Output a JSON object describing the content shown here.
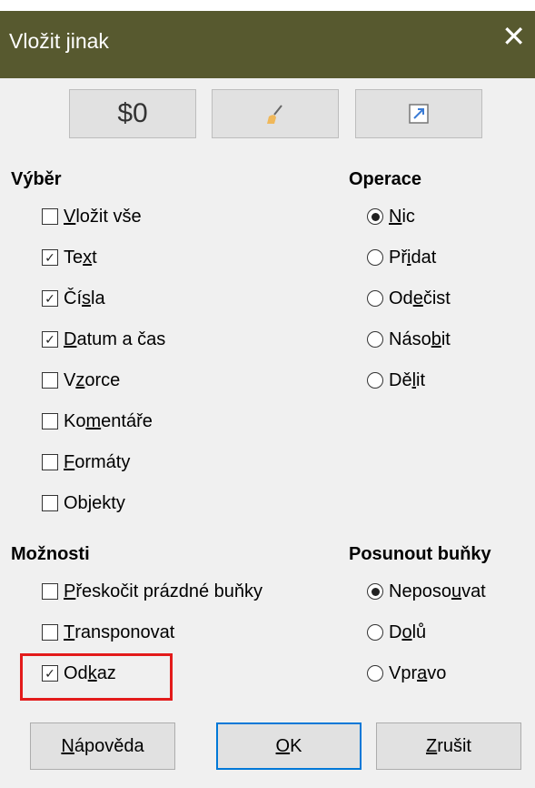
{
  "window": {
    "title": "Vložit jinak"
  },
  "toolbar": {
    "values_only_label": "$0"
  },
  "selection": {
    "title": "Výběr",
    "items": [
      {
        "pre": "",
        "ul": "V",
        "post": "ložit vše",
        "checked": false
      },
      {
        "pre": "Te",
        "ul": "x",
        "post": "t",
        "checked": true
      },
      {
        "pre": "Čí",
        "ul": "s",
        "post": "la",
        "checked": true
      },
      {
        "pre": "",
        "ul": "D",
        "post": "atum a čas",
        "checked": true
      },
      {
        "pre": "V",
        "ul": "z",
        "post": "orce",
        "checked": false
      },
      {
        "pre": "Ko",
        "ul": "m",
        "post": "entáře",
        "checked": false
      },
      {
        "pre": "",
        "ul": "F",
        "post": "ormáty",
        "checked": false
      },
      {
        "pre": "Ob",
        "ul": "j",
        "post": "ekty",
        "checked": false
      }
    ]
  },
  "operation": {
    "title": "Operace",
    "items": [
      {
        "pre": "",
        "ul": "N",
        "post": "ic",
        "selected": true
      },
      {
        "pre": "Př",
        "ul": "i",
        "post": "dat",
        "selected": false
      },
      {
        "pre": "Od",
        "ul": "e",
        "post": "čist",
        "selected": false
      },
      {
        "pre": "Náso",
        "ul": "b",
        "post": "it",
        "selected": false
      },
      {
        "pre": "Dě",
        "ul": "l",
        "post": "it",
        "selected": false
      }
    ]
  },
  "options": {
    "title": "Možnosti",
    "items": [
      {
        "pre": "",
        "ul": "P",
        "post": "řeskočit prázdné buňky",
        "checked": false
      },
      {
        "pre": "",
        "ul": "T",
        "post": "ransponovat",
        "checked": false
      },
      {
        "pre": "Od",
        "ul": "k",
        "post": "az",
        "checked": true
      }
    ]
  },
  "shift": {
    "title": "Posunout buňky",
    "items": [
      {
        "pre": "Neposo",
        "ul": "u",
        "post": "vat",
        "selected": true
      },
      {
        "pre": "D",
        "ul": "o",
        "post": "lů",
        "selected": false
      },
      {
        "pre": "Vpr",
        "ul": "a",
        "post": "vo",
        "selected": false
      }
    ]
  },
  "buttons": {
    "help": {
      "pre": "",
      "ul": "N",
      "post": "ápověda"
    },
    "ok": {
      "pre": "",
      "ul": "O",
      "post": "K"
    },
    "cancel": {
      "pre": "",
      "ul": "Z",
      "post": "rušit"
    }
  },
  "colors": {
    "titlebar": "#57592f",
    "highlight": "#e31b1b",
    "default_button_border": "#0078d7"
  }
}
